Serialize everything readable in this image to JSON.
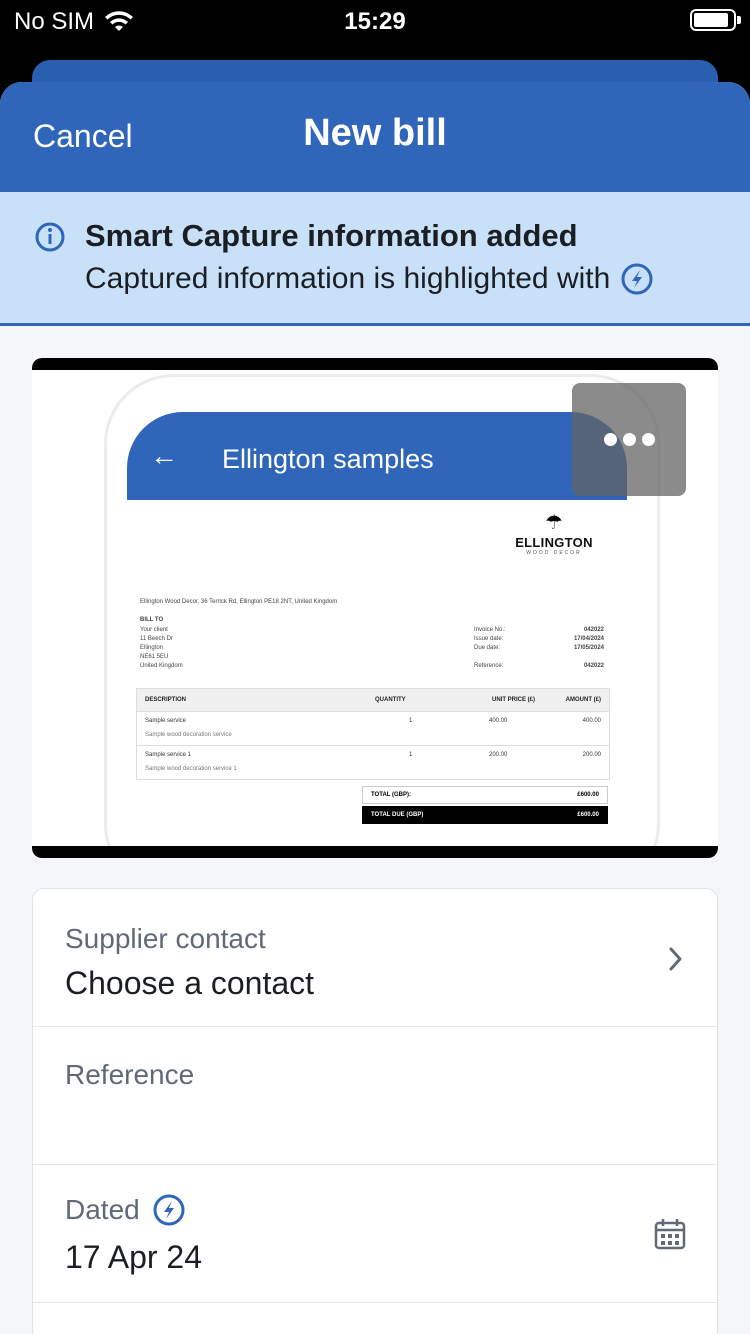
{
  "status_bar": {
    "carrier": "No SIM",
    "time": "15:29"
  },
  "nav": {
    "cancel": "Cancel",
    "title": "New bill"
  },
  "banner": {
    "title": "Smart Capture information added",
    "text": "Captured information is highlighted with"
  },
  "preview": {
    "screen_title": "Ellington samples",
    "invoice": {
      "logo_name": "ELLINGTON",
      "logo_sub": "WOOD DECOR",
      "from_line": "Ellington Wood Decor, 36 Terrick Rd, Ellington PE18 2NT, United Kingdom",
      "bill_to_label": "BILL TO",
      "bill_to": "Your client\n11 Beech Dr\nEllington\nNE61 5EU\nUnited Kingdom",
      "meta_labels": "Invoice No.:\nIssue date:\nDue date:\n\nReference:",
      "meta_values": "042022\n17/04/2024\n17/05/2024\n\n042022",
      "columns": [
        "DESCRIPTION",
        "QUANTITY",
        "UNIT PRICE (£)",
        "AMOUNT (£)"
      ],
      "lines": [
        {
          "desc": "Sample service",
          "sub": "Sample wood decoration service",
          "qty": "1",
          "price": "400.00",
          "amount": "400.00"
        },
        {
          "desc": "Sample service 1",
          "sub": "Sample wood decoration service 1",
          "qty": "1",
          "price": "200.00",
          "amount": "200.00"
        }
      ],
      "total_label": "TOTAL (GBP):",
      "total_value": "£600.00",
      "total_due_label": "TOTAL DUE (GBP)",
      "total_due_value": "£600.00"
    }
  },
  "form": {
    "supplier": {
      "label": "Supplier contact",
      "value": "Choose a contact"
    },
    "reference": {
      "label": "Reference",
      "value": ""
    },
    "dated": {
      "label": "Dated",
      "value": "17 Apr 24"
    }
  },
  "colors": {
    "brand_blue": "#2f66b9",
    "banner_bg": "#c9e1f8"
  },
  "icons": [
    "wifi-icon",
    "battery-icon",
    "info-icon",
    "smart-capture-icon",
    "more-icon",
    "chevron-right-icon",
    "calendar-icon",
    "back-arrow-icon"
  ]
}
